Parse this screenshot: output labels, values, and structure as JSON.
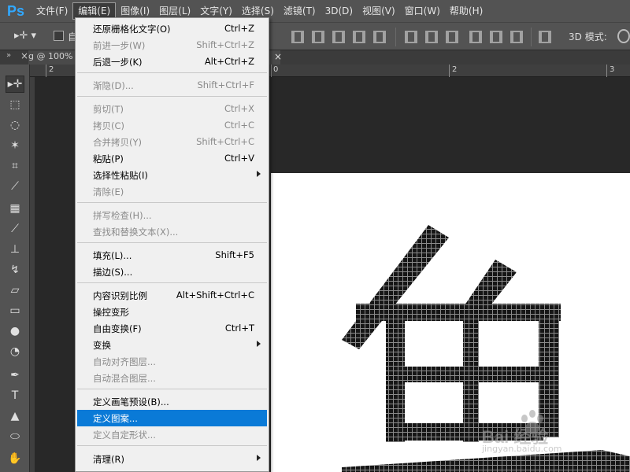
{
  "app": {
    "logo": "Ps",
    "accent": "#31a8ff"
  },
  "menubar": {
    "items": [
      "文件(F)",
      "编辑(E)",
      "图像(I)",
      "图层(L)",
      "文字(Y)",
      "选择(S)",
      "滤镜(T)",
      "3D(D)",
      "视图(V)",
      "窗口(W)",
      "帮助(H)"
    ],
    "active_index": 1
  },
  "options": {
    "checkbox_label": "自",
    "mode_label": "3D 模式:"
  },
  "document": {
    "tab_title": "g @ 100%"
  },
  "ruler": {
    "labels": [
      "2",
      "0",
      "2",
      "3"
    ]
  },
  "edit_menu": {
    "items": [
      {
        "label": "还原栅格化文字(O)",
        "shortcut": "Ctrl+Z",
        "disabled": false
      },
      {
        "label": "前进一步(W)",
        "shortcut": "Shift+Ctrl+Z",
        "disabled": true
      },
      {
        "label": "后退一步(K)",
        "shortcut": "Alt+Ctrl+Z",
        "disabled": false
      },
      {
        "label": "渐隐(D)...",
        "shortcut": "Shift+Ctrl+F",
        "disabled": true
      },
      {
        "label": "剪切(T)",
        "shortcut": "Ctrl+X",
        "disabled": true
      },
      {
        "label": "拷贝(C)",
        "shortcut": "Ctrl+C",
        "disabled": true
      },
      {
        "label": "合并拷贝(Y)",
        "shortcut": "Shift+Ctrl+C",
        "disabled": true
      },
      {
        "label": "粘贴(P)",
        "shortcut": "Ctrl+V",
        "disabled": false
      },
      {
        "label": "选择性粘贴(I)",
        "shortcut": "",
        "disabled": false,
        "submenu": true
      },
      {
        "label": "清除(E)",
        "shortcut": "",
        "disabled": true
      },
      {
        "label": "拼写检查(H)...",
        "shortcut": "",
        "disabled": true
      },
      {
        "label": "查找和替换文本(X)...",
        "shortcut": "",
        "disabled": true
      },
      {
        "label": "填充(L)...",
        "shortcut": "Shift+F5",
        "disabled": false
      },
      {
        "label": "描边(S)...",
        "shortcut": "",
        "disabled": false
      },
      {
        "label": "内容识别比例",
        "shortcut": "Alt+Shift+Ctrl+C",
        "disabled": false
      },
      {
        "label": "操控变形",
        "shortcut": "",
        "disabled": false
      },
      {
        "label": "自由变换(F)",
        "shortcut": "Ctrl+T",
        "disabled": false
      },
      {
        "label": "变换",
        "shortcut": "",
        "disabled": false,
        "submenu": true
      },
      {
        "label": "自动对齐图层...",
        "shortcut": "",
        "disabled": true
      },
      {
        "label": "自动混合图层...",
        "shortcut": "",
        "disabled": true
      },
      {
        "label": "定义画笔预设(B)...",
        "shortcut": "",
        "disabled": false
      },
      {
        "label": "定义图案...",
        "shortcut": "",
        "disabled": false,
        "highlighted": true
      },
      {
        "label": "定义自定形状...",
        "shortcut": "",
        "disabled": true
      },
      {
        "label": "清理(R)",
        "shortcut": "",
        "disabled": false,
        "submenu": true
      }
    ]
  },
  "canvas": {
    "glyph_description_color": "#111111",
    "highlight_color": "#0a7ad7"
  },
  "watermark": {
    "text": "Bai 经验",
    "subtext": "jingyan.baidu.com"
  }
}
